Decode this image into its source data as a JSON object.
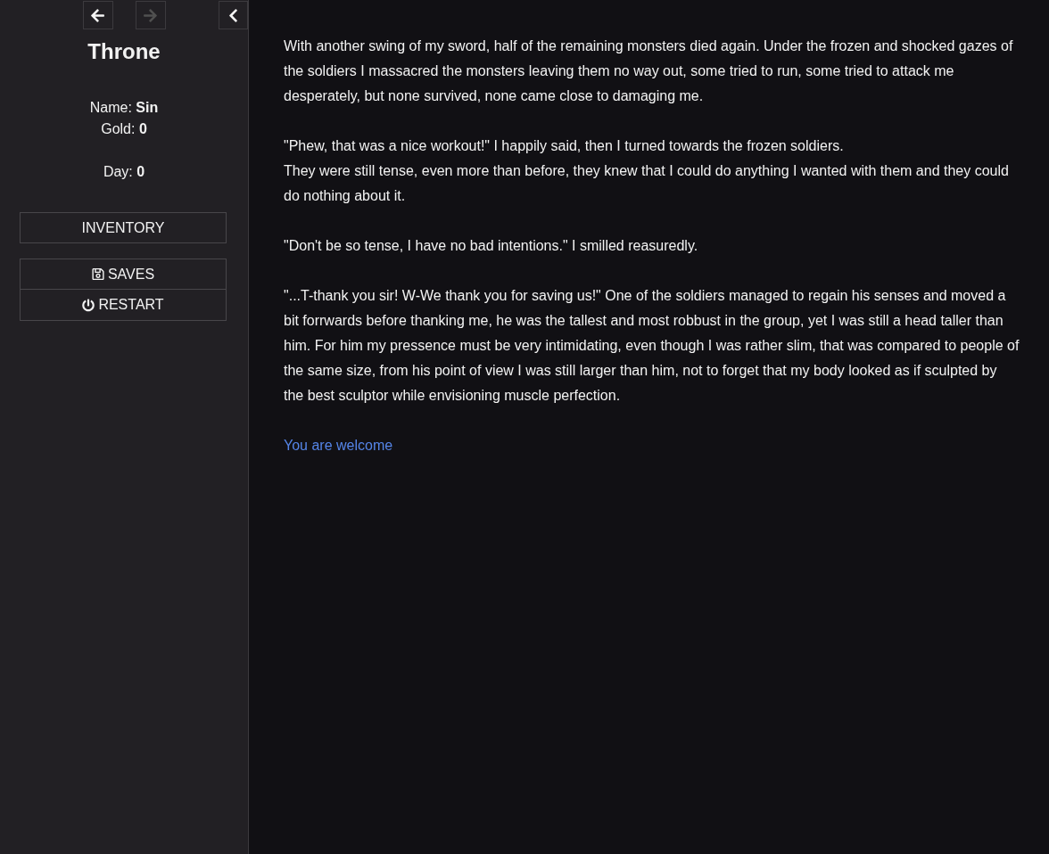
{
  "nav": {
    "history": [
      {
        "kind": "back",
        "disabled": false
      },
      {
        "kind": "forward",
        "disabled": true
      }
    ],
    "collapse": {
      "disabled": false
    }
  },
  "sidebar": {
    "title": "Throne",
    "stat_groups": [
      [
        "Name: **Sin**",
        "Gold: **0**"
      ],
      [
        "Day: **0**"
      ]
    ],
    "menu_groups": [
      [
        {
          "kind": "plain",
          "label": "INVENTORY"
        }
      ],
      [
        {
          "kind": "save",
          "label": "SAVES"
        },
        {
          "kind": "restart",
          "label": "RESTART"
        }
      ]
    ]
  },
  "passage": {
    "paragraphs": [
      [
        "With another swing of my sword, half of the remaining monsters died again. Under the frozen and shocked gazes of the soldiers I massacred the monsters leaving them no way out, some tried to run, some tried to attack me desperately, but none survived, none came close to damaging me."
      ],
      [
        "\"Phew, that was a nice workout!\" I happily said, then I turned towards the frozen soldiers.",
        "They were still tense, even more than before, they knew that I could do anything I wanted with them and they could do nothing about it."
      ],
      [
        "\"Don't be so tense, I have no bad intentions.\" I smilled reasuredly."
      ],
      [
        "\"...T-thank you sir! W-We thank you for saving us!\" One of the soldiers managed to regain his senses and moved a bit forrwards before thanking me, he was the tallest and most robbust in the group, yet I was still a head taller than him. For him my pressence must be very intimidating, even though I was rather slim, that was compared to people of the same size, from his point of view I was still larger than him, not to forget that my body looked as if sculpted by the best sculptor while envisioning muscle perfection."
      ]
    ],
    "links": [
      "You are welcome"
    ]
  }
}
